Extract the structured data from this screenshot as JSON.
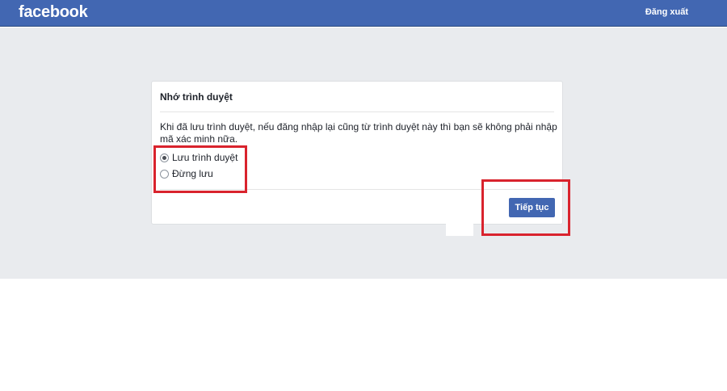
{
  "header": {
    "logo": "facebook",
    "logout_label": "Đăng xuất"
  },
  "dialog": {
    "title": "Nhớ trình duyệt",
    "description": "Khi đã lưu trình duyệt, nếu đăng nhập lại cũng từ trình duyệt này thì bạn sẽ không phải nhập mã xác minh nữa.",
    "options": [
      {
        "label": "Lưu trình duyệt",
        "selected": true
      },
      {
        "label": "Đừng lưu",
        "selected": false
      }
    ],
    "continue_label": "Tiếp tục"
  },
  "colors": {
    "brand": "#4267b2",
    "background": "#e9ebee",
    "highlight": "#d9232d"
  }
}
